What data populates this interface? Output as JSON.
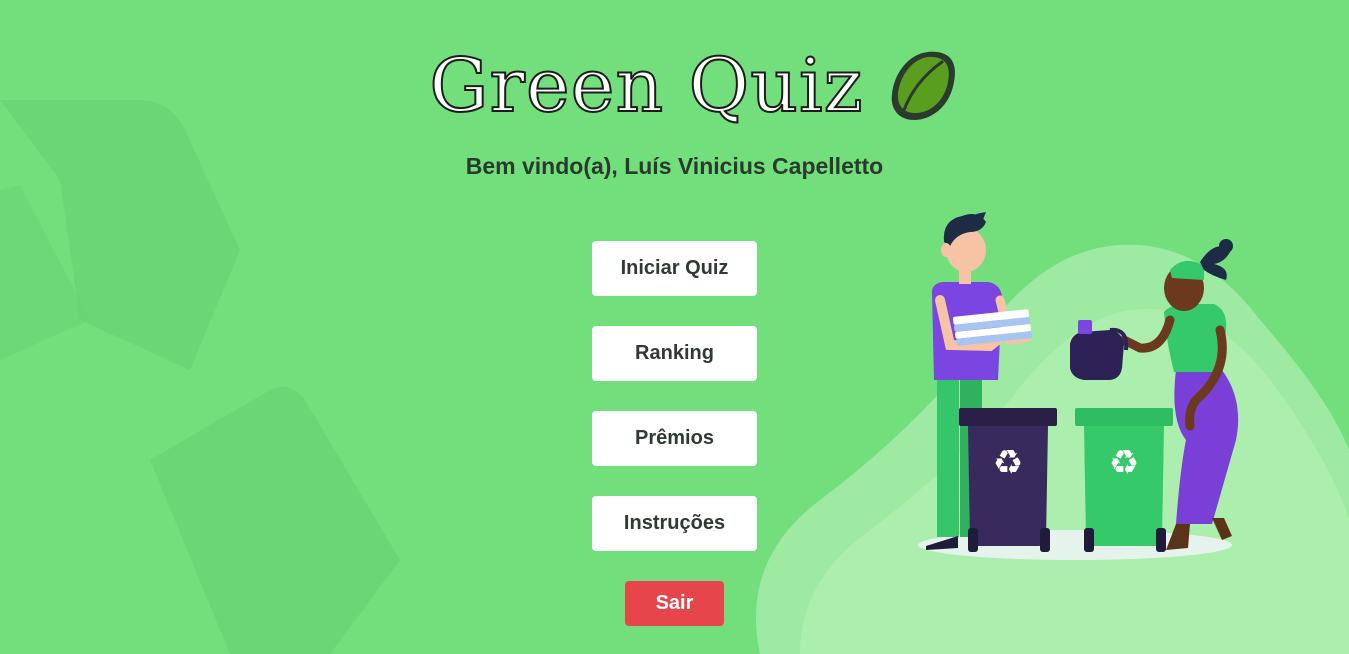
{
  "app": {
    "title": "Green Quiz",
    "welcome": "Bem vindo(a), Luís Vinicius Capelletto"
  },
  "menu": {
    "start_label": "Iniciar Quiz",
    "ranking_label": "Ranking",
    "prizes_label": "Prêmios",
    "instructions_label": "Instruções",
    "exit_label": "Sair"
  },
  "icons": {
    "title_icon": "leaf-icon",
    "background": "recycle-symbol",
    "illustration": "people-recycling-illustration"
  },
  "colors": {
    "background": "#72df7c",
    "button_bg": "#ffffff",
    "button_text": "#2f3a33",
    "exit_bg": "#e6464b",
    "leaf": "#5a9e1f"
  }
}
